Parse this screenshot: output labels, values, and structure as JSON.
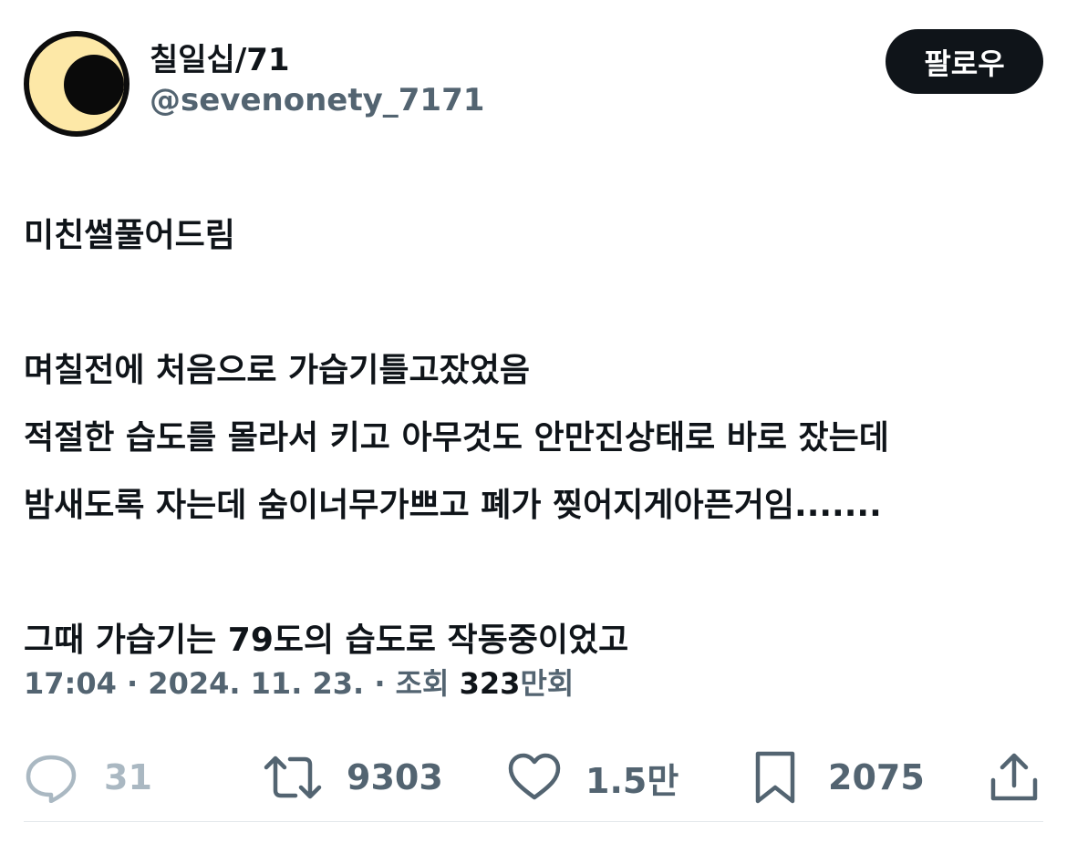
{
  "author": {
    "display_name": "칠일십/71",
    "handle": "@sevenonety_7171",
    "avatar_icon": "crescent-moon-avatar"
  },
  "follow_button": {
    "label": "팔로우"
  },
  "tweet": {
    "lines": [
      "미친썰풀어드림",
      "",
      "며칠전에 처음으로 가습기틀고잤었음",
      "적절한 습도를 몰라서 키고 아무것도 안만진상태로 바로 잤는데",
      "밤새도록 자는데 숨이너무가쁘고 폐가 찢어지게아픈거임.......",
      "",
      "그때 가습기는 79도의 습도로 작동중이었고"
    ]
  },
  "meta": {
    "time": "17:04",
    "sep1": " · ",
    "date": "2024. 11. 23.",
    "sep2": " · ",
    "views_label": "조회 ",
    "views_value": "323",
    "views_unit": "만회"
  },
  "actions": {
    "reply": {
      "icon": "reply-icon",
      "count": "31"
    },
    "retweet": {
      "icon": "retweet-icon",
      "count": "9303"
    },
    "like": {
      "icon": "heart-icon",
      "count": "1.5만"
    },
    "bookmark": {
      "icon": "bookmark-icon",
      "count": "2075"
    },
    "share": {
      "icon": "share-icon"
    }
  },
  "colors": {
    "text": "#0f1419",
    "secondary": "#536471",
    "reply_muted": "#aab8c2",
    "avatar_bg": "#fde8a7",
    "button_bg": "#0f1419"
  }
}
